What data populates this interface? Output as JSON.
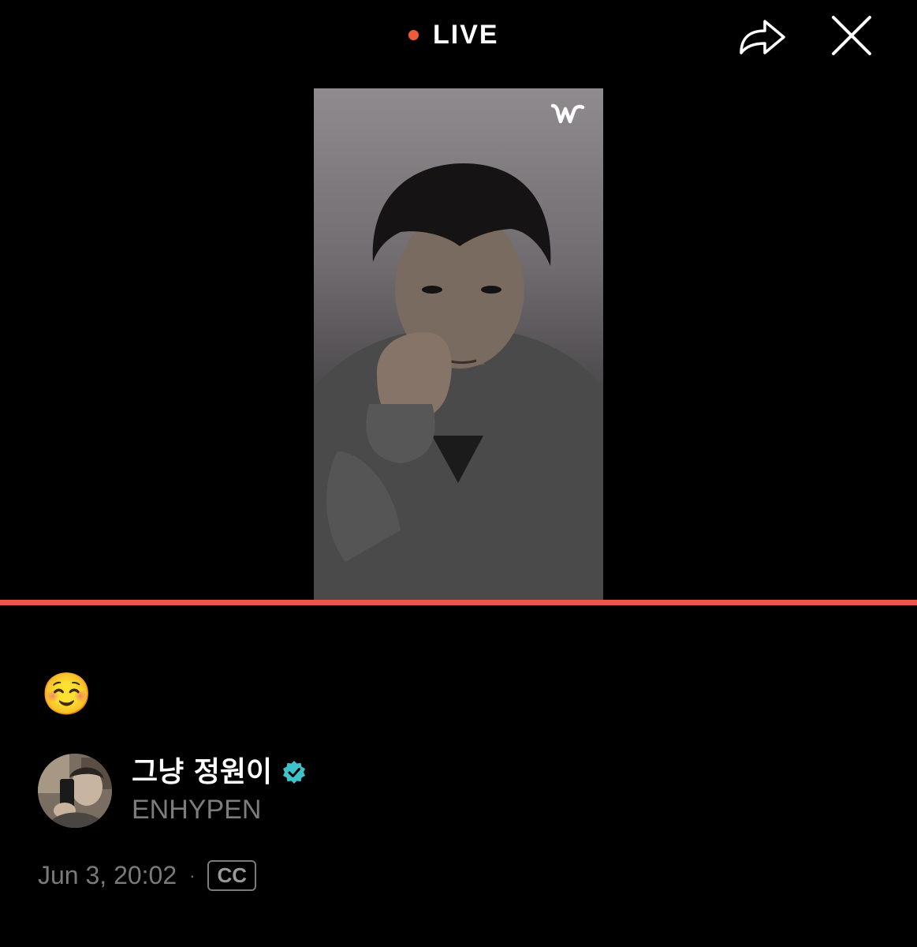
{
  "header": {
    "live_label": "LIVE",
    "live_dot_color": "#ee5a3c",
    "share_icon": "share-arrow-icon",
    "close_icon": "close-icon"
  },
  "video": {
    "logo_icon": "weverse-logo-icon",
    "progress": 1.0,
    "progress_color": "#e8574d"
  },
  "post": {
    "emoji": "☺️",
    "author": {
      "display_name": "그냥 정원이",
      "group": "ENHYPEN",
      "verified_color": "#3fc1c9"
    },
    "timestamp": "Jun 3, 20:02",
    "separator": "·",
    "cc_label": "CC"
  }
}
